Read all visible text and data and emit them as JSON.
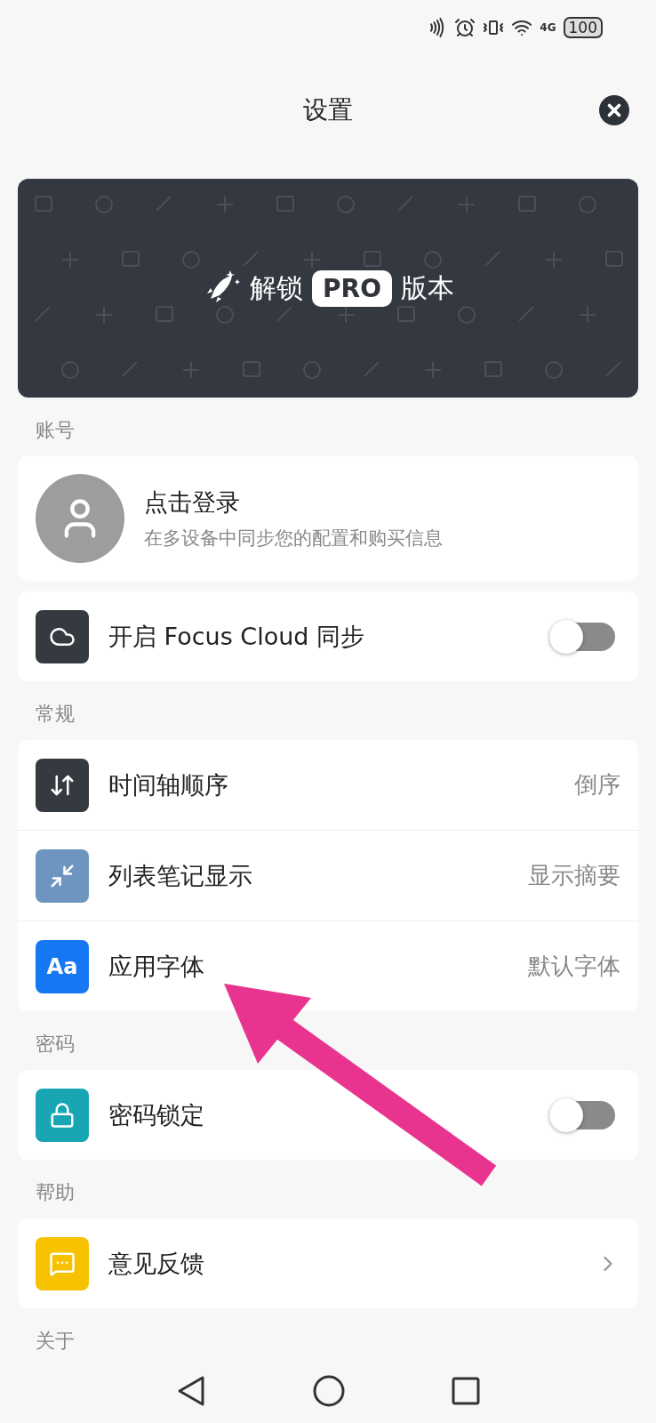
{
  "status_bar": {
    "battery": "100",
    "network": "4G"
  },
  "header": {
    "title": "设置"
  },
  "banner": {
    "text_before": "解锁",
    "badge": "PRO",
    "text_after": "版本"
  },
  "groups": [
    {
      "label": "账号",
      "cards": [
        {
          "rows": [
            {
              "kind": "account",
              "title": "点击登录",
              "subtitle": "在多设备中同步您的配置和购买信息"
            }
          ]
        },
        {
          "rows": [
            {
              "kind": "toggle",
              "title": "开启 Focus Cloud 同步",
              "color": "#353a41",
              "on": false
            }
          ]
        }
      ]
    },
    {
      "label": "常规",
      "cards": [
        {
          "rows": [
            {
              "kind": "value",
              "title": "时间轴顺序",
              "color": "#353a41",
              "value": "倒序"
            },
            {
              "kind": "value",
              "title": "列表笔记显示",
              "color": "#6e95c0",
              "value": "显示摘要"
            },
            {
              "kind": "value",
              "title": "应用字体",
              "color": "#1677f2",
              "icon_text": "Aa",
              "value": "默认字体"
            }
          ]
        }
      ]
    },
    {
      "label": "密码",
      "cards": [
        {
          "rows": [
            {
              "kind": "toggle",
              "title": "密码锁定",
              "color": "#19a6b3",
              "on": false
            }
          ]
        }
      ]
    },
    {
      "label": "帮助",
      "cards": [
        {
          "rows": [
            {
              "kind": "link",
              "title": "意见反馈",
              "color": "#f7c300"
            }
          ]
        }
      ]
    },
    {
      "label": "关于"
    }
  ]
}
